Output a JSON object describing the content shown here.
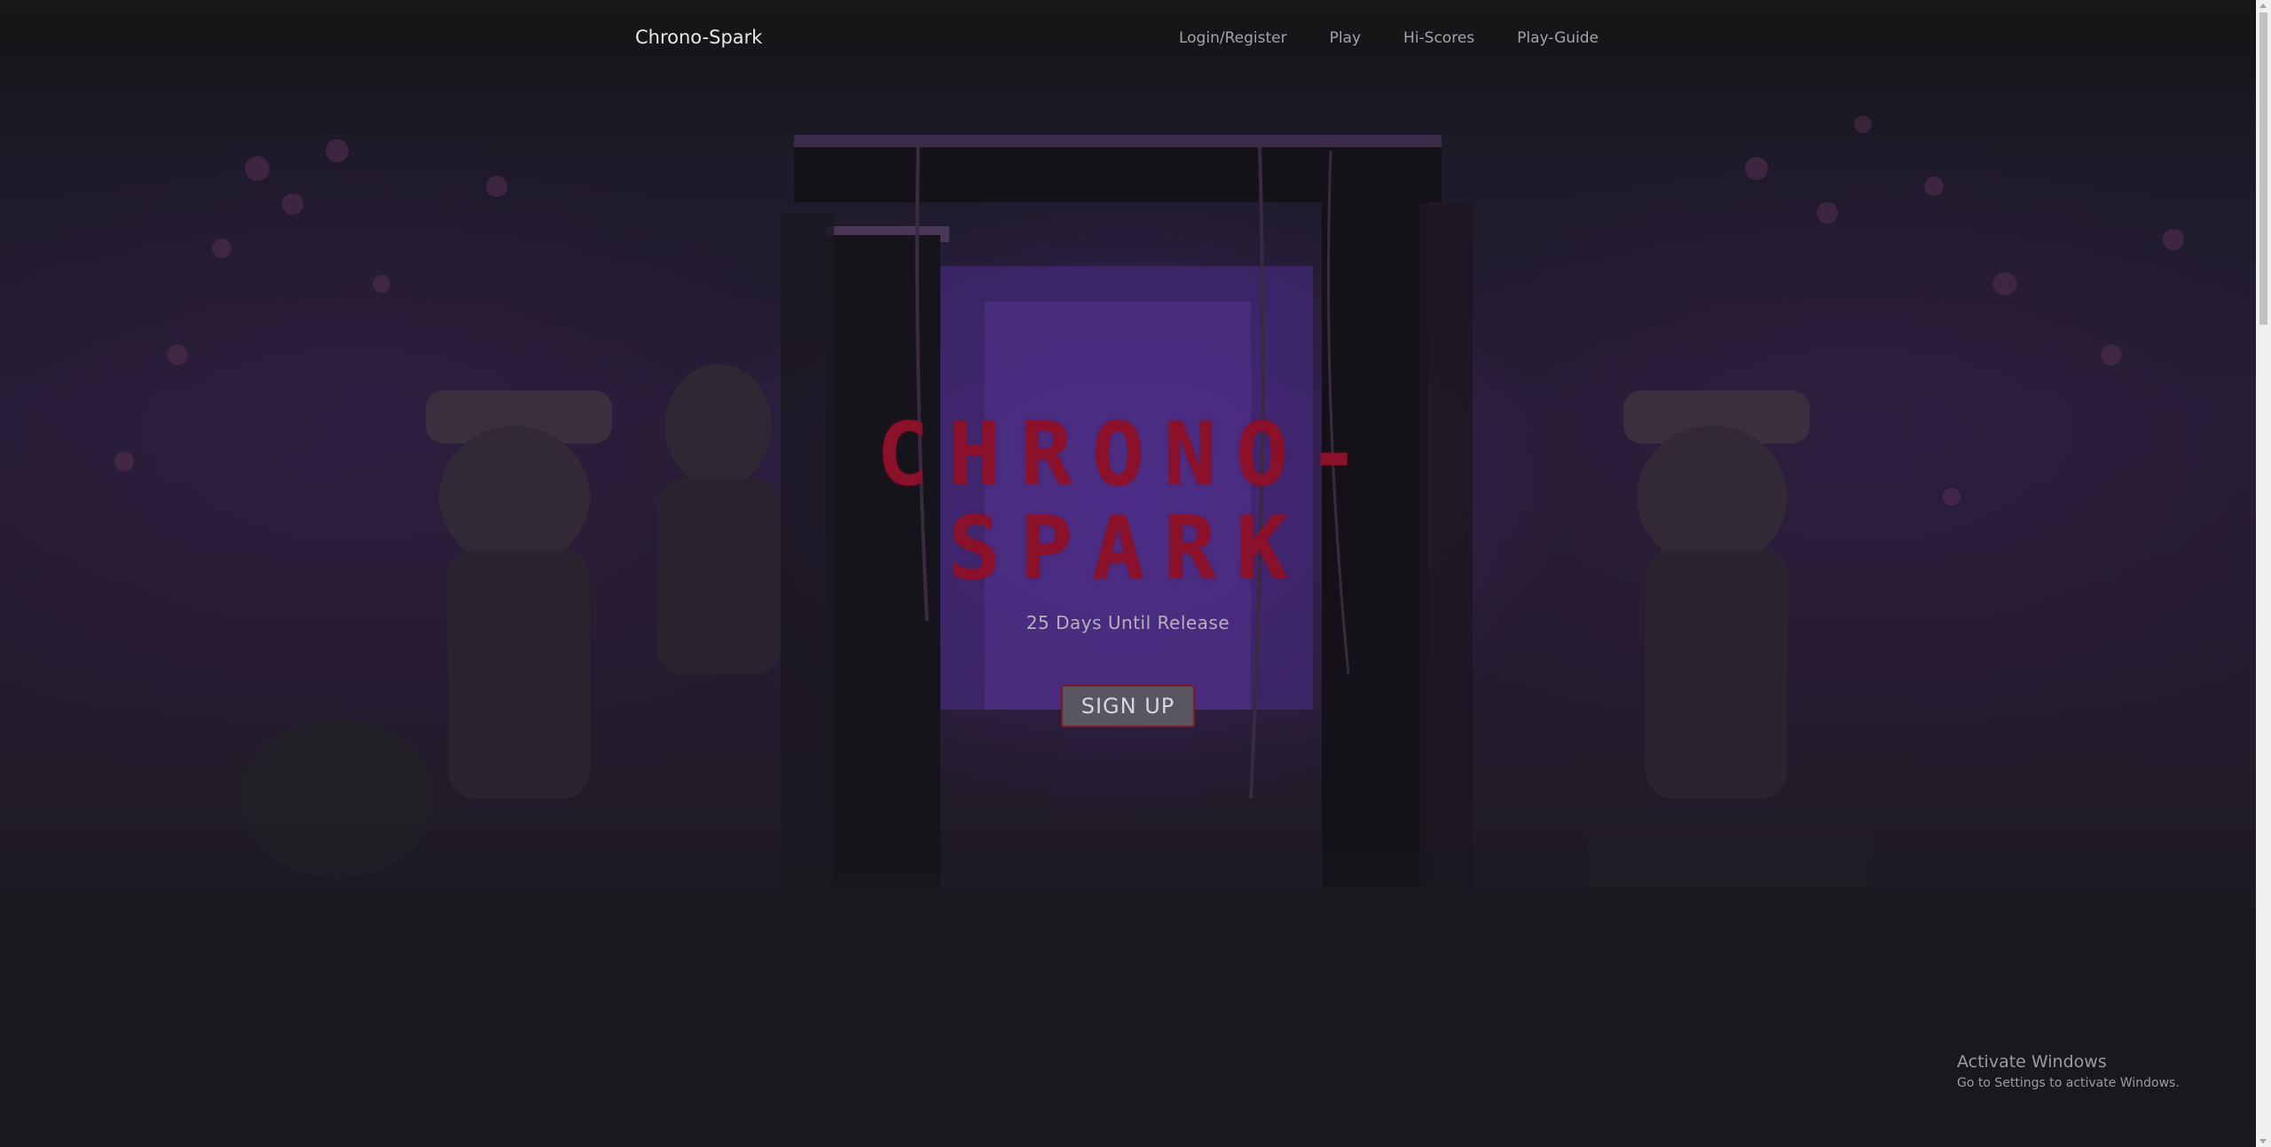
{
  "navbar": {
    "brand": "Chrono-Spark",
    "links": [
      "Login/Register",
      "Play",
      "Hi-Scores",
      "Play-Guide"
    ]
  },
  "hero": {
    "title": "CHRONO-SPARK",
    "subtitle": "25 Days Until Release",
    "cta_label": "SIGN UP"
  },
  "watermark": {
    "title": "Activate Windows",
    "subtitle": "Go to Settings to activate Windows."
  },
  "colors": {
    "background": "#19181d",
    "title_red": "#8a1129",
    "button_bg": "#5a5660",
    "button_border": "#7a1a2e",
    "nav_text": "#a3a3a8",
    "accent_purple": "#54289a"
  }
}
